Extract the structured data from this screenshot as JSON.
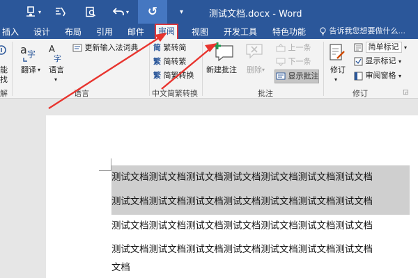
{
  "titlebar": {
    "doc_title": "测试文档.docx - Word",
    "undo_symbol": "↺"
  },
  "tabs": [
    {
      "label": "插入"
    },
    {
      "label": "设计"
    },
    {
      "label": "布局"
    },
    {
      "label": "引用"
    },
    {
      "label": "邮件"
    },
    {
      "label": "审阅",
      "active": true
    },
    {
      "label": "视图"
    },
    {
      "label": "开发工具"
    },
    {
      "label": "特色功能"
    }
  ],
  "tell_me": "告诉我您想要做什么...",
  "ribbon": {
    "proofing_left": {
      "btn1": "能",
      "btn2": "找",
      "group": "解"
    },
    "language": {
      "translate": "翻译",
      "language": "语言",
      "update_ime": "更新输入法词典",
      "group": "语言"
    },
    "chinese_conversion": {
      "trad_to_simp": "繁转简",
      "simp_to_trad": "简转繁",
      "conversion": "简繁转换",
      "group": "中文简繁转换"
    },
    "comments": {
      "new_comment": "新建批注",
      "delete": "删除",
      "previous": "上一条",
      "next": "下一条",
      "show_comments": "显示批注",
      "group": "批注"
    },
    "tracking": {
      "track_changes": "修订",
      "simple_markup": "简单标记",
      "show_markup": "显示标记",
      "review_pane": "审阅窗格",
      "group": "修订"
    }
  },
  "document": {
    "lines": [
      "测试文档测试文档测试文档测试文档测试文档测试文档测试文档",
      "测试文档测试文档测试文档测试文档测试文档测试文档测试文档",
      "测试文档测试文档测试文档测试文档测试文档测试文档测试文档",
      "测试文档测试文档测试文档测试文档测试文档测试文档测试文档",
      "文档"
    ],
    "selected_line_count": 2
  },
  "annotation": {
    "arrow_color": "#e8342e"
  }
}
